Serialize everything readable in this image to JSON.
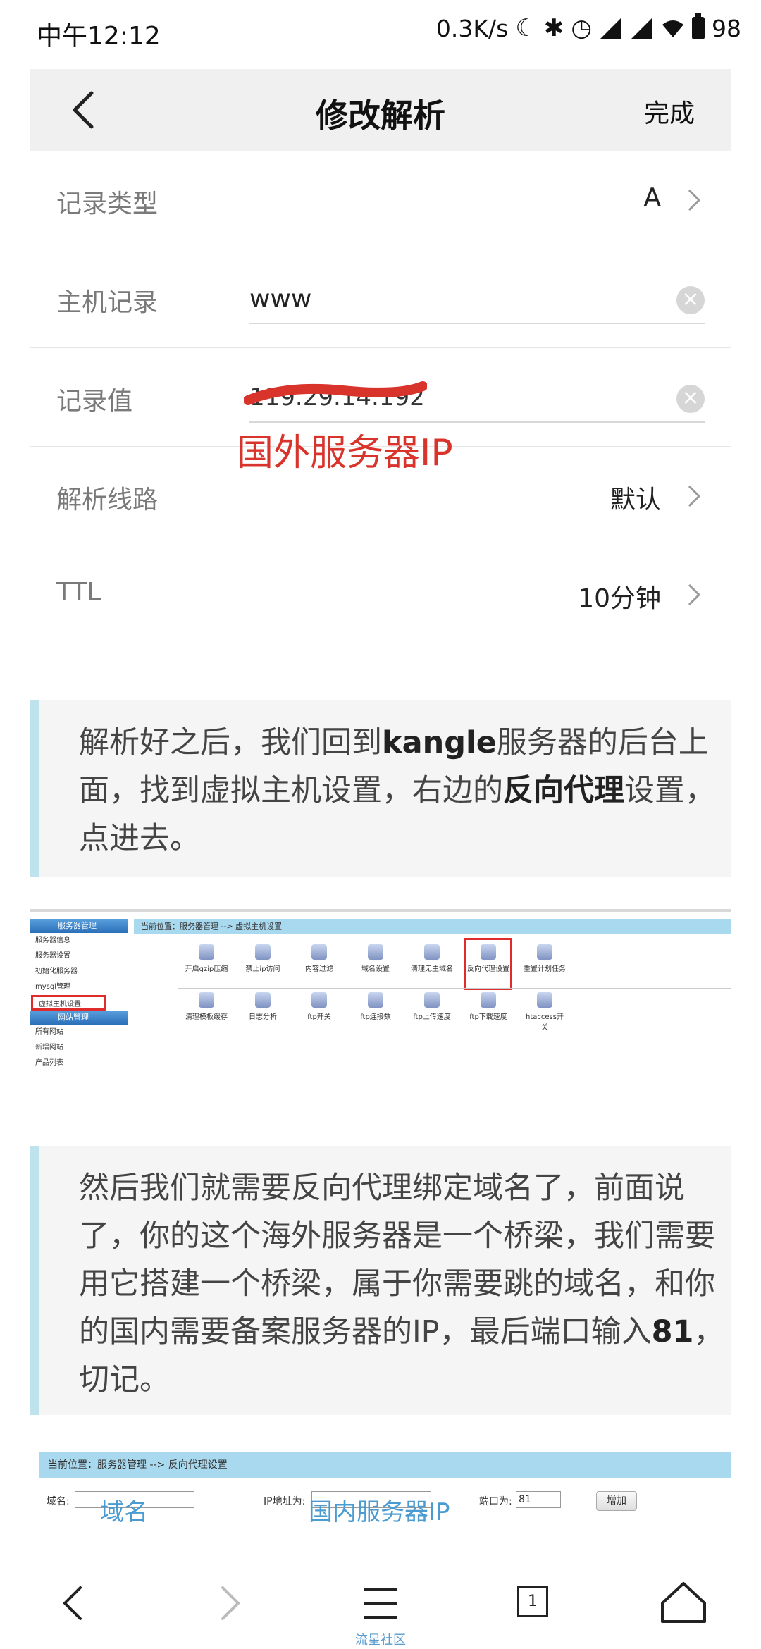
{
  "status_bar": {
    "time": "中午12:12",
    "net_speed": "0.3K/s",
    "battery": "98"
  },
  "header": {
    "title": "修改解析",
    "done_label": "完成"
  },
  "form": {
    "record_type": {
      "label": "记录类型",
      "value": "A"
    },
    "host_record": {
      "label": "主机记录",
      "value": "www"
    },
    "record_value": {
      "label": "记录值",
      "value": "119.29.14.192"
    },
    "line": {
      "label": "解析线路",
      "value": "默认"
    },
    "ttl": {
      "label": "TTL",
      "value": "10分钟"
    }
  },
  "annotation_red": "国外服务器IP",
  "quote1": {
    "t1": "解析好之后，我们回到",
    "b1": "kangle",
    "t2": "服务器的后台上面，找到虚拟主机设置，右边的",
    "b2": "反向代理",
    "t3": "设置，点进去。"
  },
  "screenshot1": {
    "breadcrumb": "当前位置：服务器管理 --> 虚拟主机设置",
    "sidebar_section1": "服务器管理",
    "sidebar_items1": [
      "服务器信息",
      "服务器设置",
      "初始化服务器",
      "mysql管理",
      "虚拟主机设置"
    ],
    "sidebar_section2": "网站管理",
    "sidebar_items2": [
      "所有网站",
      "新增网站",
      "产品列表"
    ],
    "row1": [
      "开启gzip压缩",
      "禁止ip访问",
      "内容过滤",
      "域名设置",
      "清理无主域名",
      "反向代理设置",
      "重置计划任务"
    ],
    "row2": [
      "清理模板缓存",
      "日志分析",
      "ftp开关",
      "ftp连接数",
      "ftp上传速度",
      "ftp下载速度",
      "htaccess开关"
    ]
  },
  "quote2": {
    "t1": "然后我们就需要反向代理绑定域名了，前面说了，你的这个海外服务器是一个桥梁，我们需要用它搭建一个桥梁，属于你需要跳的域名，和你的国内需要备案服务器的IP，最后端口输入",
    "b1": "81",
    "t2": "，切记。"
  },
  "screenshot2": {
    "breadcrumb": "当前位置：服务器管理 --> 反向代理设置",
    "domain_label": "域名:",
    "ip_label": "IP地址为:",
    "port_label": "端口为:",
    "port_value": "81",
    "add_button": "增加",
    "annotation_domain": "域名",
    "annotation_ip": "国内服务器IP"
  },
  "bottom_nav": {
    "tab_count": "1",
    "watermark": "流星社区"
  }
}
